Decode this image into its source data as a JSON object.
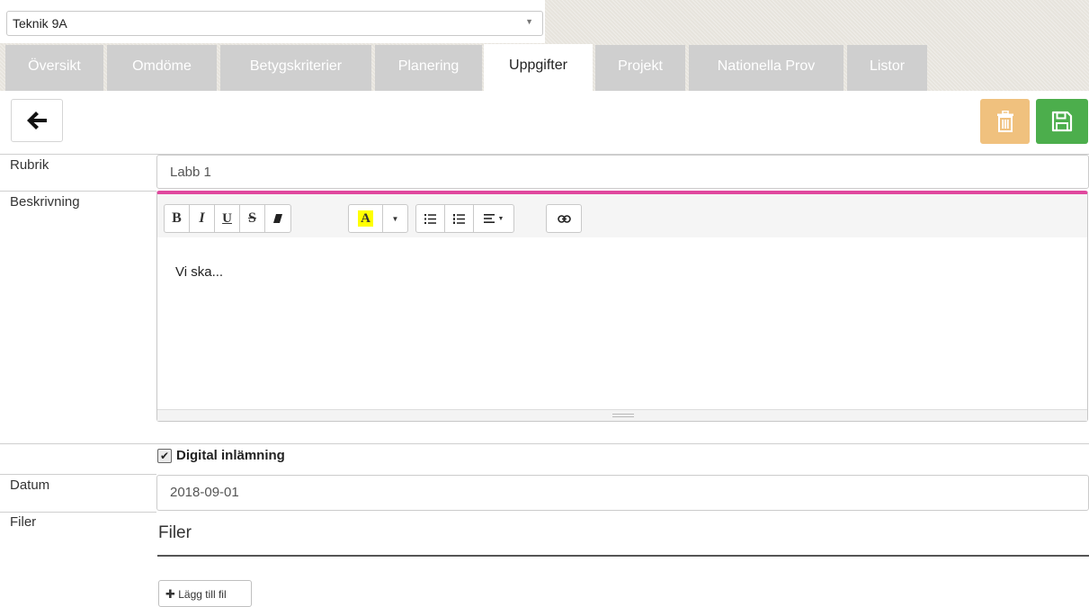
{
  "header": {
    "course_select": {
      "value": "Teknik 9A"
    },
    "tabs": [
      {
        "label": "Översikt"
      },
      {
        "label": "Omdöme"
      },
      {
        "label": "Betygskriterier"
      },
      {
        "label": "Planering"
      },
      {
        "label": "Uppgifter",
        "active": true
      },
      {
        "label": "Projekt"
      },
      {
        "label": "Nationella Prov"
      },
      {
        "label": "Listor"
      }
    ]
  },
  "toolbar": {
    "back_icon": "arrow-left-icon",
    "delete_icon": "trash-icon",
    "save_icon": "floppy-disk-icon",
    "delete_color": "#f0c17e",
    "save_color": "#4cae4c"
  },
  "form": {
    "rubrik_label": "Rubrik",
    "rubrik_value": "Labb 1",
    "beskrivning_label": "Beskrivning",
    "editor_accent": "#e0489e",
    "editor_buttons": {
      "bold": "B",
      "italic": "I",
      "underline": "U",
      "strikethrough": "S",
      "eraser_icon": "eraser-icon",
      "font_color": "A",
      "dropdown_icon": "caret-down-icon",
      "unordered_list_icon": "list-ul-icon",
      "ordered_list_icon": "list-ol-icon",
      "align_icon": "align-icon",
      "link_icon": "link-icon"
    },
    "editor_content": "Vi ska...",
    "digital_label": "Digital inlämning",
    "digital_checked": true,
    "datum_label": "Datum",
    "datum_value": "2018-09-01",
    "filer_label": "Filer",
    "filer_title": "Filer",
    "add_file_label": "Lägg till fil"
  }
}
